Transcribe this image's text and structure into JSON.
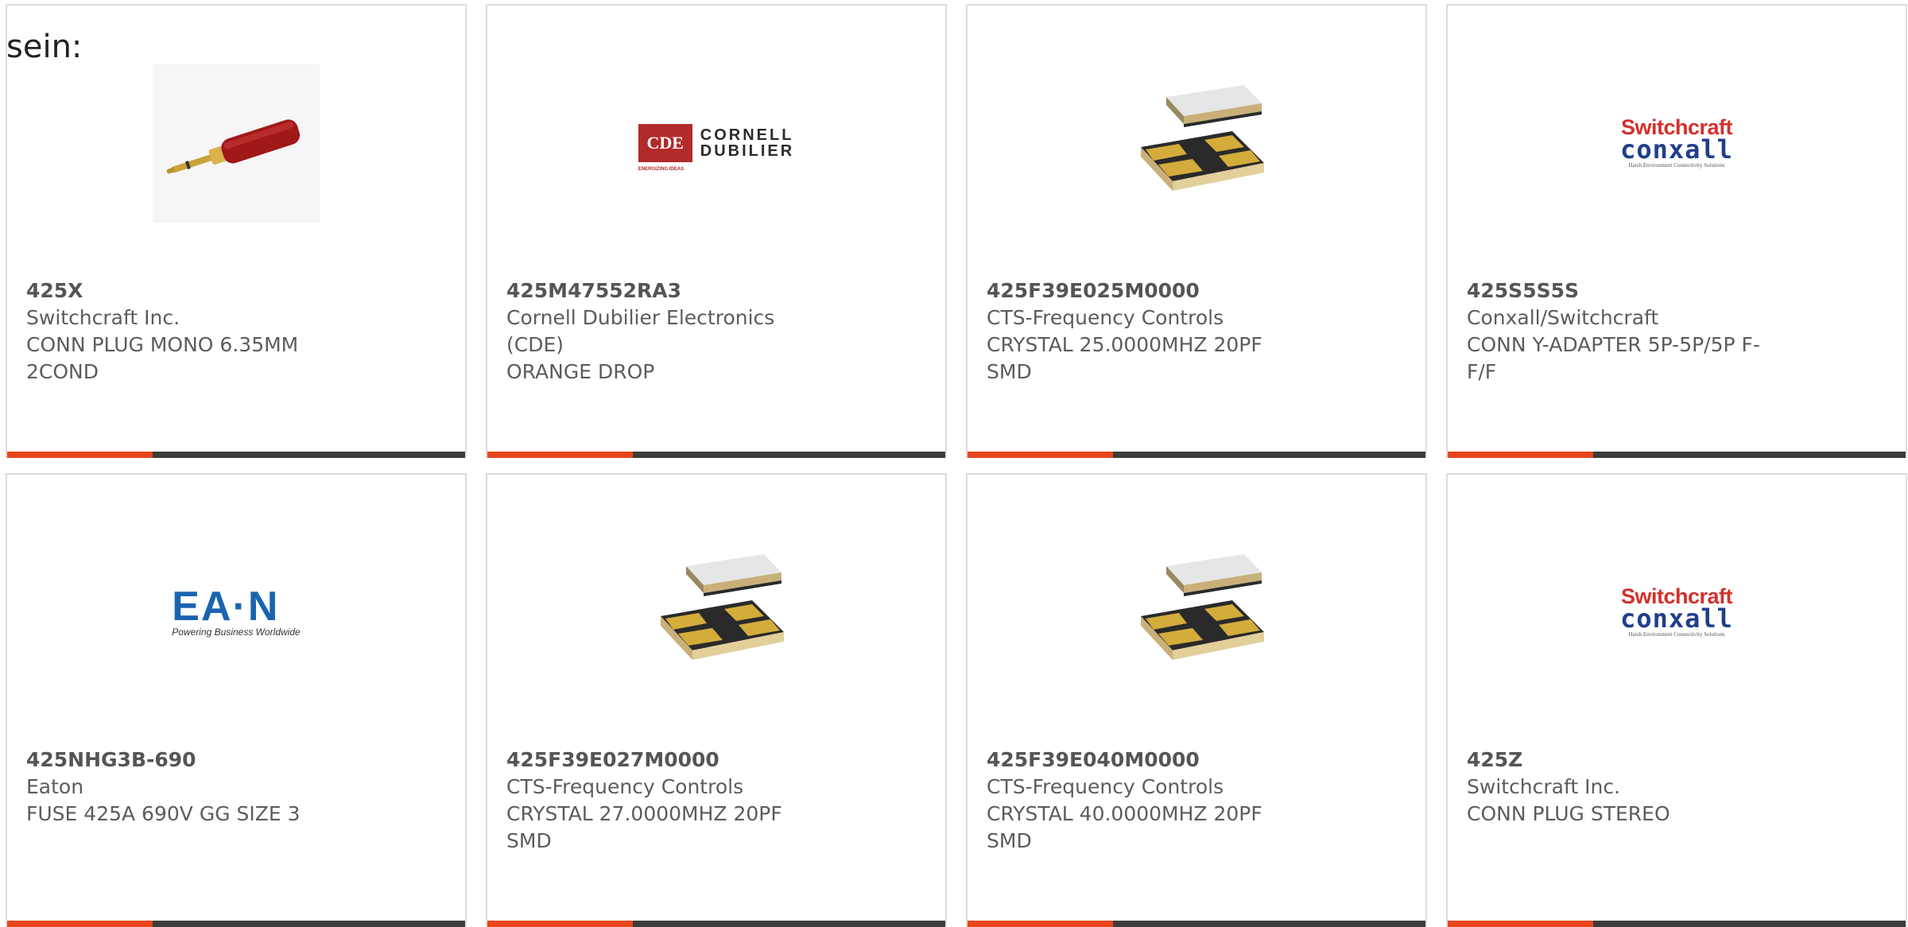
{
  "caption": "sein:",
  "cards": [
    {
      "part": "425X",
      "maker": "Switchcraft Inc.",
      "desc": "CONN PLUG MONO 6.35MM 2COND",
      "image": "mono-plug-image"
    },
    {
      "part": "425M47552RA3",
      "maker": "Cornell Dubilier Electronics (CDE)",
      "desc": "ORANGE DROP",
      "image": "cde-logo",
      "logo": {
        "box": "CDE",
        "line1": "CORNELL",
        "line2": "DUBILIER",
        "tagline": "ENERGIZING IDEAS"
      }
    },
    {
      "part": "425F39E025M0000",
      "maker": "CTS-Frequency Controls",
      "desc": "CRYSTAL 25.0000MHZ 20PF SMD",
      "image": "crystal-image"
    },
    {
      "part": "425S5S5S",
      "maker": "Conxall/Switchcraft",
      "desc": "CONN Y-ADAPTER 5P-5P/5P F-F/F",
      "image": "switchcraft-conxall-logo",
      "logo": {
        "top": "Switchcraft",
        "mid": "conxall",
        "sub": "Harsh Environment Connectivity Solutions"
      }
    },
    {
      "part": "425NHG3B-690",
      "maker": "Eaton",
      "desc": "FUSE 425A 690V GG SIZE 3",
      "image": "eaton-logo",
      "logo": {
        "main": "EA·N",
        "tag": "Powering Business Worldwide"
      }
    },
    {
      "part": "425F39E027M0000",
      "maker": "CTS-Frequency Controls",
      "desc": "CRYSTAL 27.0000MHZ 20PF SMD",
      "image": "crystal-image"
    },
    {
      "part": "425F39E040M0000",
      "maker": "CTS-Frequency Controls",
      "desc": "CRYSTAL 40.0000MHZ 20PF SMD",
      "image": "crystal-image"
    },
    {
      "part": "425Z",
      "maker": "Switchcraft Inc.",
      "desc": "CONN PLUG STEREO",
      "image": "switchcraft-conxall-logo",
      "logo": {
        "top": "Switchcraft",
        "mid": "conxall",
        "sub": "Harsh Environment Connectivity Solutions"
      }
    }
  ],
  "colors": {
    "accent": "#e8461c",
    "bar": "#3c3c3c",
    "border": "#dcdcdc"
  }
}
